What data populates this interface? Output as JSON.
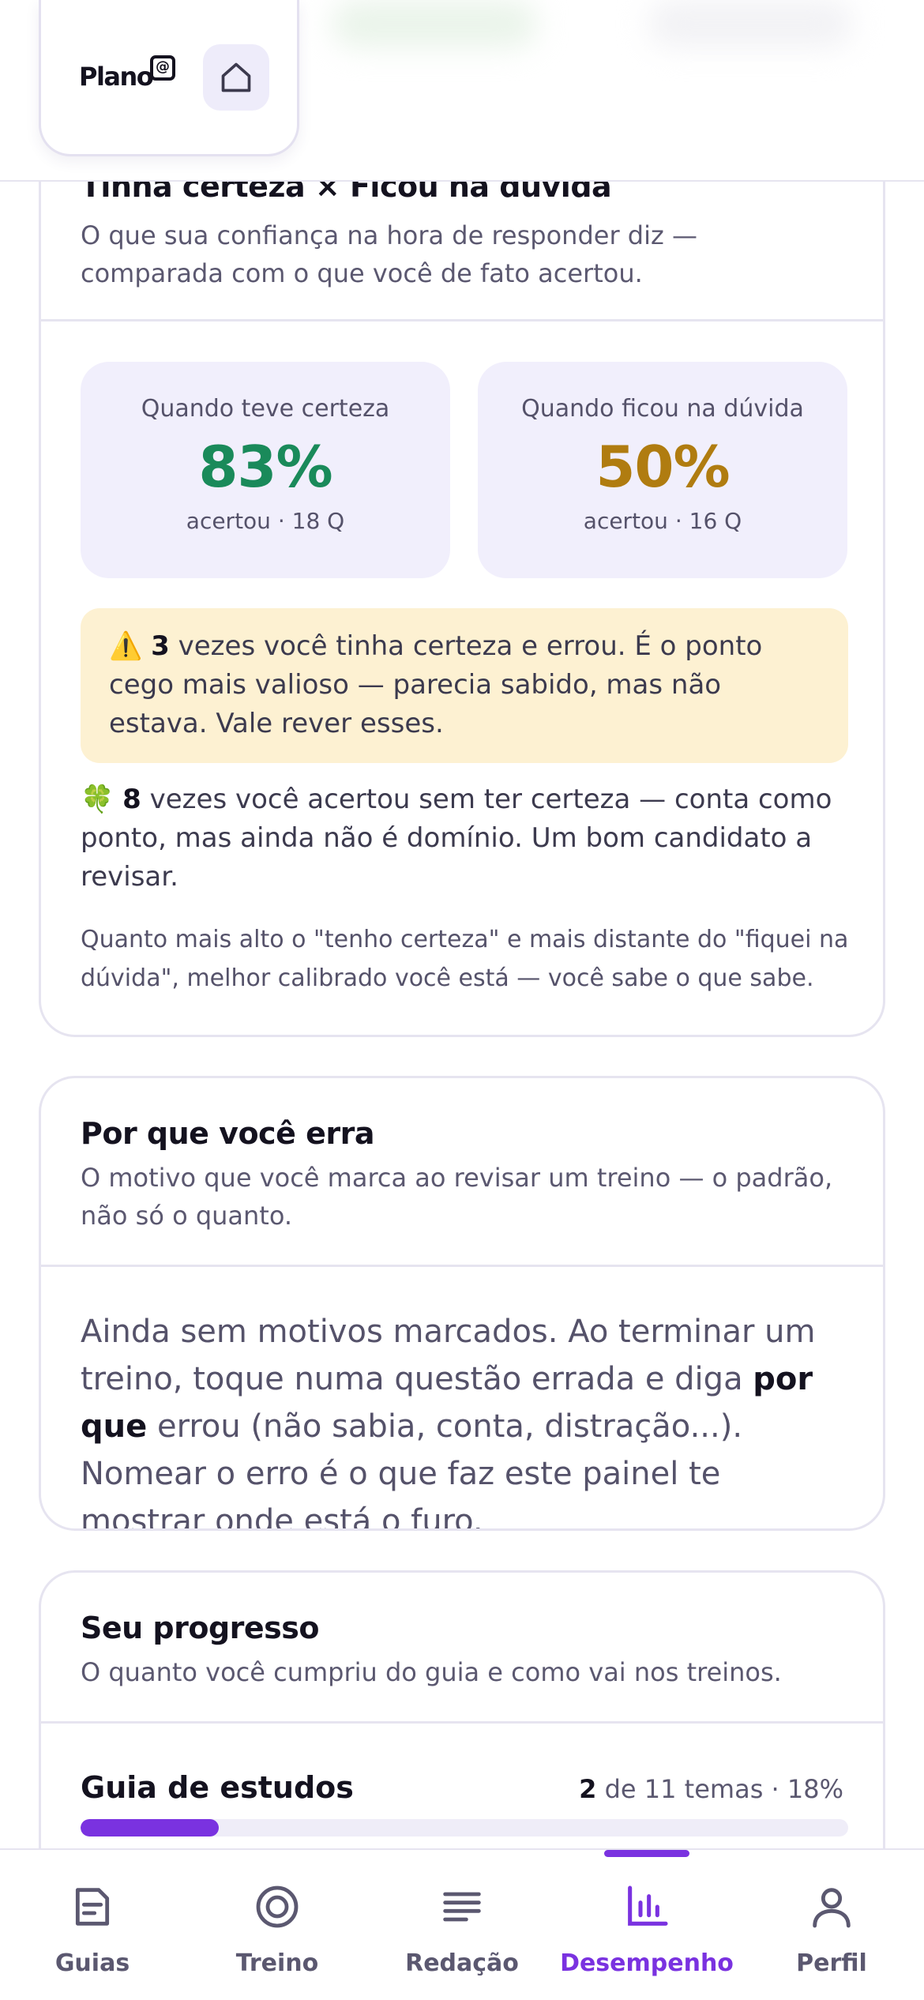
{
  "header": {
    "brand": "Plano",
    "brand_mark": "@",
    "home_icon": "home-icon"
  },
  "calibration": {
    "title": "Tinha certeza × Ficou na dúvida",
    "subtitle": "O que sua confiança na hora de responder diz — comparada com o que você de fato acertou.",
    "certain": {
      "label": "Quando teve certeza",
      "value": "83%",
      "meta": "acertou · 18 Q",
      "color": "#1a8a5a"
    },
    "doubt": {
      "label": "Quando ficou na dúvida",
      "value": "50%",
      "meta": "acertou · 16 Q",
      "color": "#b07c10"
    },
    "warning": {
      "emoji": "⚠️",
      "count": "3",
      "text": "vezes você tinha certeza e errou. É o ponto cego mais valioso — parecia sabido, mas não estava. Vale rever esses."
    },
    "clover": {
      "emoji": "🍀",
      "count": "8",
      "text": "vezes você acertou sem ter certeza — conta como ponto, mas ainda não é domínio. Um bom candidato a revisar."
    },
    "note": "Quanto mais alto o \"tenho certeza\" e mais distante do \"fiquei na dúvida\", melhor calibrado você está — você sabe o que sabe."
  },
  "errors": {
    "title": "Por que você erra",
    "subtitle": "O motivo que você marca ao revisar um treino — o padrão, não só o quanto.",
    "body_before": "Ainda sem motivos marcados. Ao terminar um treino, toque numa questão errada e diga ",
    "body_bold": "por que",
    "body_after": " errou (não sabia, conta, distração...). Nomear o erro é o que faz este painel te mostrar onde está o furo."
  },
  "progress": {
    "title": "Seu progresso",
    "subtitle": "O quanto você cumpriu do guia e como vai nos treinos.",
    "guide_label": "Guia de estudos",
    "done": "2",
    "total_text": "de 11 temas · 18%",
    "fraction": 0.18
  },
  "nav": {
    "active": "Desempenho",
    "items": [
      {
        "label": "Guias",
        "icon": "document-icon"
      },
      {
        "label": "Treino",
        "icon": "target-icon"
      },
      {
        "label": "Redação",
        "icon": "text-lines-icon"
      },
      {
        "label": "Desempenho",
        "icon": "bar-chart-icon"
      },
      {
        "label": "Perfil",
        "icon": "user-icon"
      }
    ],
    "accent": "#7a32e0"
  }
}
